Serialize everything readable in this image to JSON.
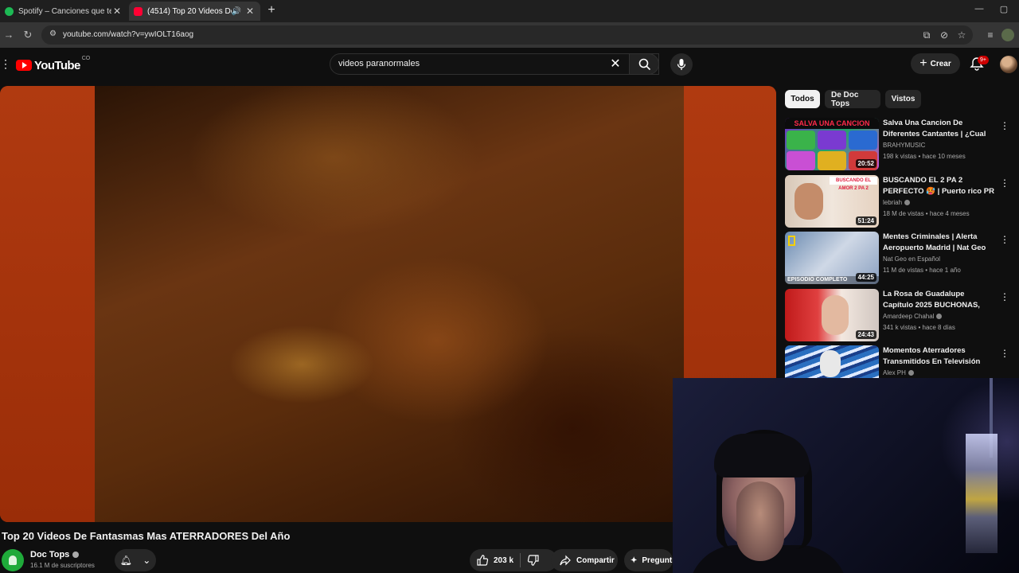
{
  "browser": {
    "tabs": [
      {
        "title": "Spotify – Canciones que te gus",
        "close": "✕"
      },
      {
        "title": "(4514) Top 20 Videos De Fa",
        "close": "✕"
      }
    ],
    "new_tab": "+",
    "url": "youtube.com/watch?v=ywIOLT16aog"
  },
  "youtube": {
    "logo_text": "YouTube",
    "country": "CO",
    "search_query": "videos paranormales",
    "create_label": "Crear",
    "notifications_badge": "9+"
  },
  "video": {
    "title": "Top 20 Videos De Fantasmas Mas ATERRADORES Del Año",
    "channel": "Doc Tops",
    "subscribers": "16.1 M de suscriptores",
    "likes": "203 k",
    "share_label": "Compartir",
    "ask_label": "Pregunt"
  },
  "sidebar": {
    "chips": [
      {
        "label": "Todos",
        "active": true
      },
      {
        "label": "De Doc Tops",
        "active": false
      },
      {
        "label": "Vistos",
        "active": false
      }
    ],
    "recommendations": [
      {
        "title": "Salva Una Cancion De Diferentes Cantantes | ¿Cual e...",
        "channel": "BRAHYMUSIC",
        "meta": "198 k vistas • hace 10 meses",
        "duration": "20:52",
        "thumb_text": "SALVA UNA CANCION"
      },
      {
        "title": "BUSCANDO EL 2 PA 2 PERFECTO 🥵 | Puerto rico PR",
        "channel": "lebriah",
        "meta": "18 M de vistas • hace 4 meses",
        "duration": "51:24",
        "thumb_text": "BUSCANDO EL AMOR 2 PA 2"
      },
      {
        "title": "Mentes Criminales | Alerta Aeropuerto Madrid | Nat Geo e...",
        "channel": "Nat Geo en Español",
        "meta": "11 M de vistas • hace 1 año",
        "duration": "44:25",
        "thumb_text": "EPISODIO COMPLETO"
      },
      {
        "title": "La Rosa de Guadalupe Capítulo 2025 BUCHONAS, CHICAS DE ...",
        "channel": "Amardeep Chahal",
        "meta": "341 k vistas • hace 8 días",
        "duration": "24:43"
      },
      {
        "title": "Momentos Aterradores Transmitidos En Televisión",
        "channel": "Alex PH",
        "meta": ""
      }
    ]
  }
}
